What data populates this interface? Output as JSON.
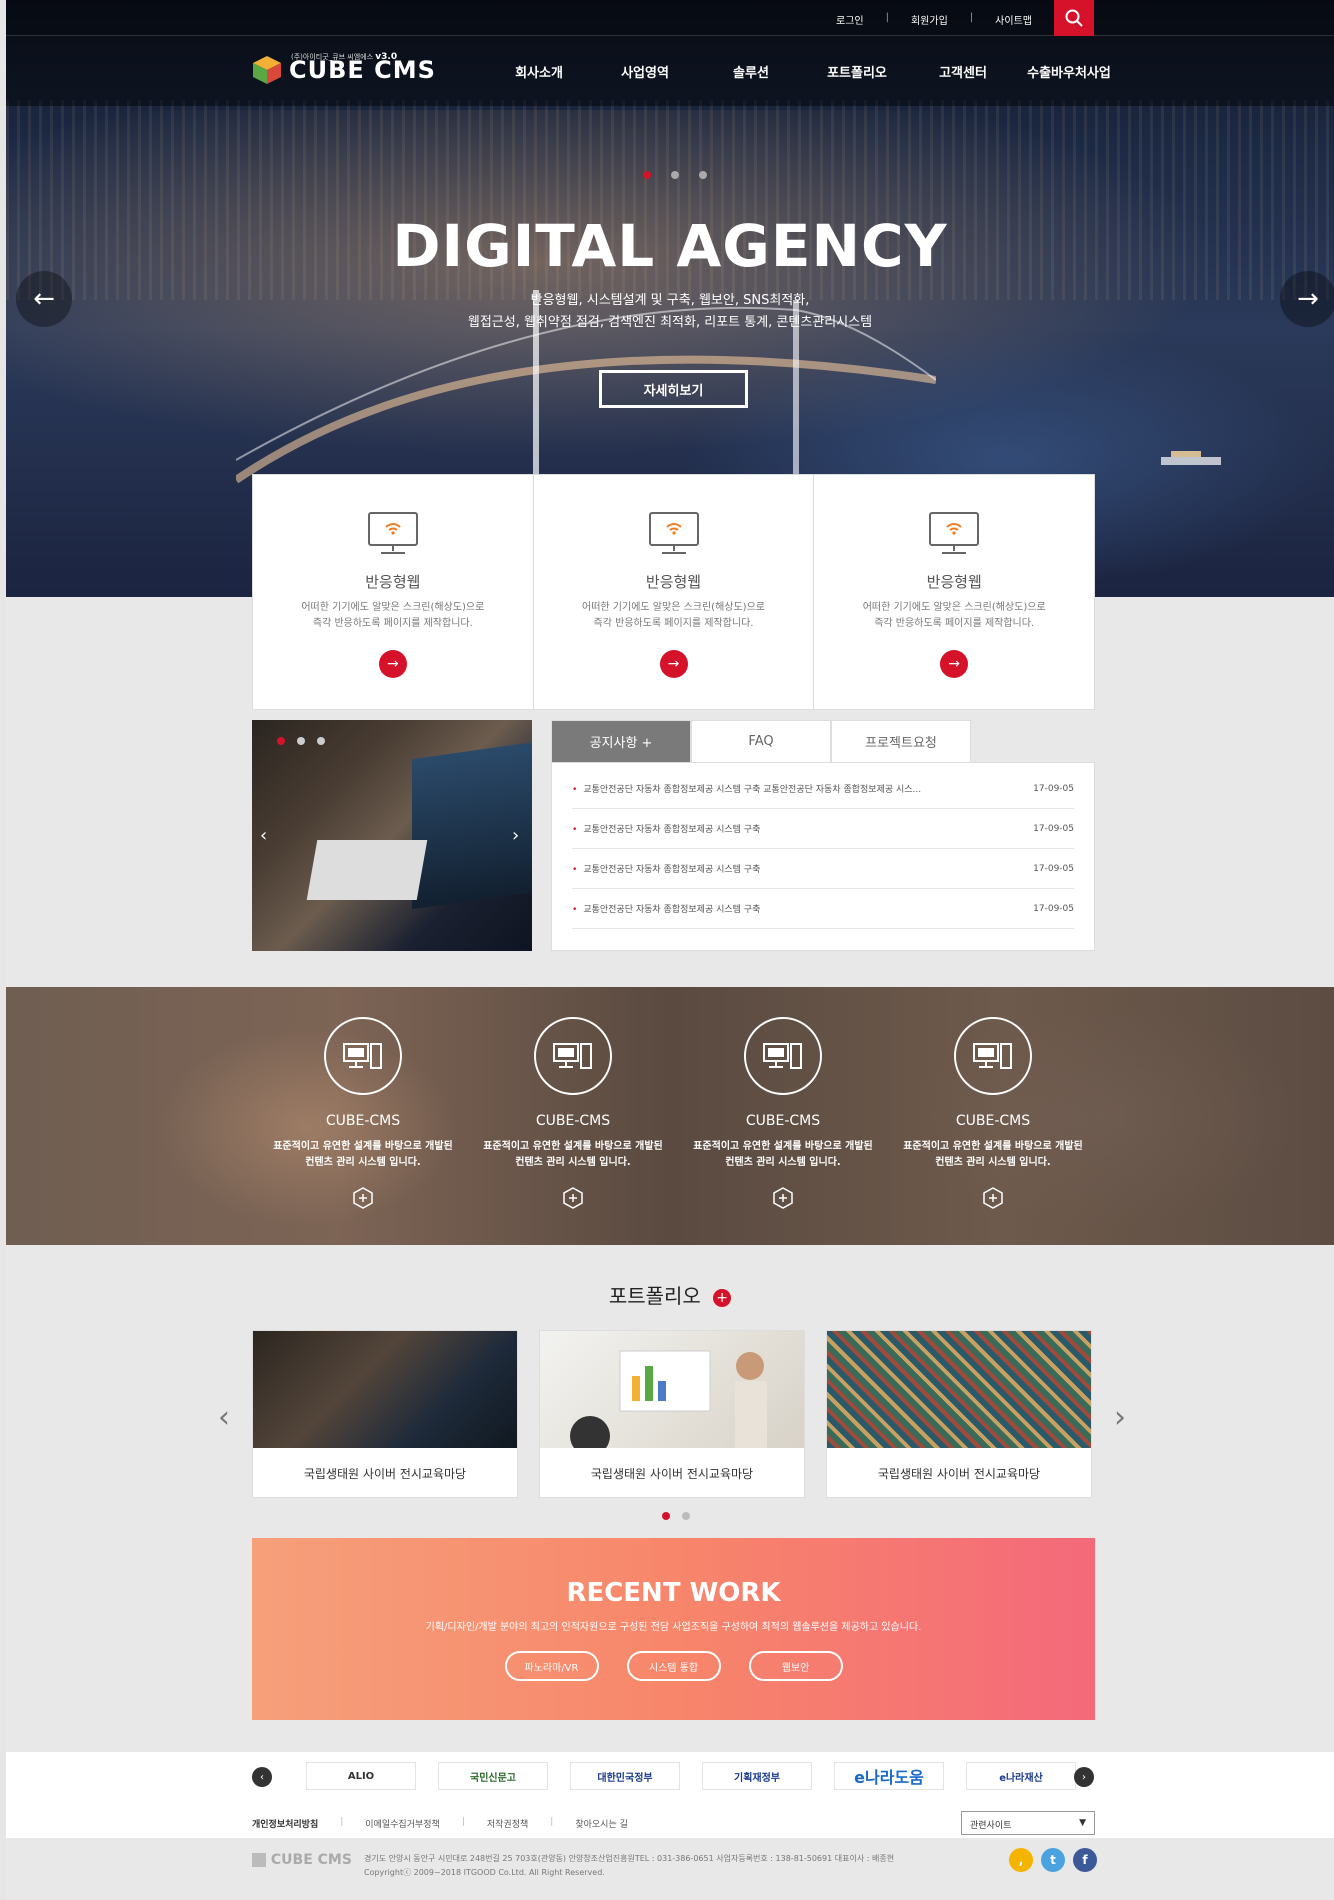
{
  "top_links": {
    "login": "로그인",
    "signup": "회원가입",
    "sitemap": "사이트맵"
  },
  "logo": {
    "name": "CUBE CMS",
    "tagline": "(주)아이티굿_큐브 씨엠에스",
    "version": "v3.0"
  },
  "menu": [
    "회사소개",
    "사업영역",
    "솔루션",
    "포트폴리오",
    "고객센터",
    "수출바우처사업"
  ],
  "hero": {
    "title": "DIGITAL AGENCY",
    "line1": "반응형웹, 시스템설계 및 구축, 웹보안, SNS최적화,",
    "line2": "웹접근성, 웹취약점 점검, 검색엔진 최적화, 리포트 통계, 콘텐츠관리시스템",
    "button": "자세히보기"
  },
  "features": [
    {
      "title": "반응형웹",
      "desc1": "어떠한 기기에도 알맞은 스크린(해상도)으로",
      "desc2": "즉각 반응하도록 페이지를 제작합니다."
    },
    {
      "title": "반응형웹",
      "desc1": "어떠한 기기에도 알맞은 스크린(해상도)으로",
      "desc2": "즉각 반응하도록 페이지를 제작합니다."
    },
    {
      "title": "반응형웹",
      "desc1": "어떠한 기기에도 알맞은 스크린(해상도)으로",
      "desc2": "즉각 반응하도록 페이지를 제작합니다."
    }
  ],
  "tabs": [
    "공지사항 +",
    "FAQ",
    "프로젝트요청"
  ],
  "notices": [
    {
      "title": "교통안전공단 자동차 종합정보제공 시스템 구축 교통안전공단 자동차 종합정보제공 시스...",
      "date": "17-09-05"
    },
    {
      "title": "교통안전공단 자동차 종합정보제공 시스템 구축",
      "date": "17-09-05"
    },
    {
      "title": "교통안전공단 자동차 종합정보제공 시스템 구축",
      "date": "17-09-05"
    },
    {
      "title": "교통안전공단 자동차 종합정보제공 시스템 구축",
      "date": "17-09-05"
    }
  ],
  "band": [
    {
      "title": "CUBE-CMS",
      "desc1": "표준적이고 유연한 설계를 바탕으로 개발된",
      "desc2": "컨텐츠 관리 시스템 입니다."
    },
    {
      "title": "CUBE-CMS",
      "desc1": "표준적이고 유연한 설계를 바탕으로 개발된",
      "desc2": "컨텐츠 관리 시스템 입니다."
    },
    {
      "title": "CUBE-CMS",
      "desc1": "표준적이고 유연한 설계를 바탕으로 개발된",
      "desc2": "컨텐츠 관리 시스템 입니다."
    },
    {
      "title": "CUBE-CMS",
      "desc1": "표준적이고 유연한 설계를 바탕으로 개발된",
      "desc2": "컨텐츠 관리 시스템 입니다."
    }
  ],
  "portfolio": {
    "title": "포트폴리오",
    "items": [
      "국립생태원 사이버 전시교육마당",
      "국립생태원 사이버 전시교육마당",
      "국립생태원 사이버 전시교육마당"
    ]
  },
  "recent": {
    "title": "RECENT WORK",
    "desc": "기획/디자인/개발 분야의 최고의 인적자원으로 구성된 전담 사업조직을 구성하여 최적의 웹솔루션을 제공하고 있습니다.",
    "buttons": [
      "파노라마/VR",
      "시스템 통합",
      "웹보안"
    ]
  },
  "partners": [
    "ALIO",
    "국민신문고",
    "대한민국정부",
    "기획재정부",
    "e나라도움",
    "e나라재산"
  ],
  "footer": {
    "links": [
      "개인정보처리방침",
      "이메일수집거부정책",
      "저작권정책",
      "찾아오시는 길"
    ],
    "related": "관련사이트",
    "address": "경기도 안양시 동안구 시민대로 248번길 25 703호(관양동) 안양창조산업진흥원TEL : 031-386-0651 사업자등록번호 : 138-81-50691 대표이사 : 배종현",
    "copyright": "Copyrightⓒ 2009~2018 ITGOOD Co.Ltd. All Right Reserved.",
    "logo": "CUBE CMS"
  },
  "colors": {
    "accent": "#d6122a",
    "tab_active": "#7a7a7a"
  }
}
